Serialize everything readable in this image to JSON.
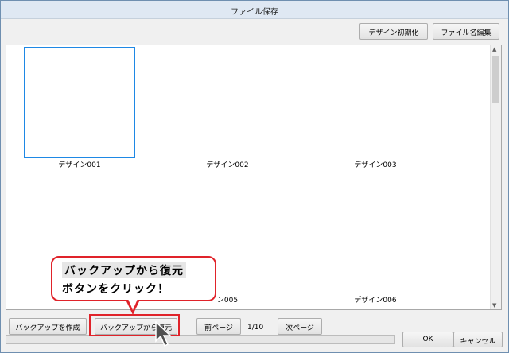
{
  "window": {
    "title": "ファイル保存"
  },
  "toolbar": {
    "reset_label": "デザイン初期化",
    "rename_label": "ファイル名編集"
  },
  "designs": [
    {
      "label": "デザイン001",
      "selected": true
    },
    {
      "label": "デザイン002"
    },
    {
      "label": "デザイン003"
    },
    {
      "label": "ン005"
    },
    {
      "label": "デザイン006"
    }
  ],
  "footer": {
    "backup_create": "バックアップを作成",
    "backup_restore": "バックアップから復元",
    "prev_page": "前ページ",
    "page_indicator": "1/10",
    "next_page": "次ページ",
    "ok": "OK",
    "cancel": "キャンセル"
  },
  "callout": {
    "line1": "バックアップから復元",
    "line2": "ボタンをクリック！"
  },
  "colors": {
    "highlight": "#e0232a",
    "selection": "#1e88e5"
  }
}
